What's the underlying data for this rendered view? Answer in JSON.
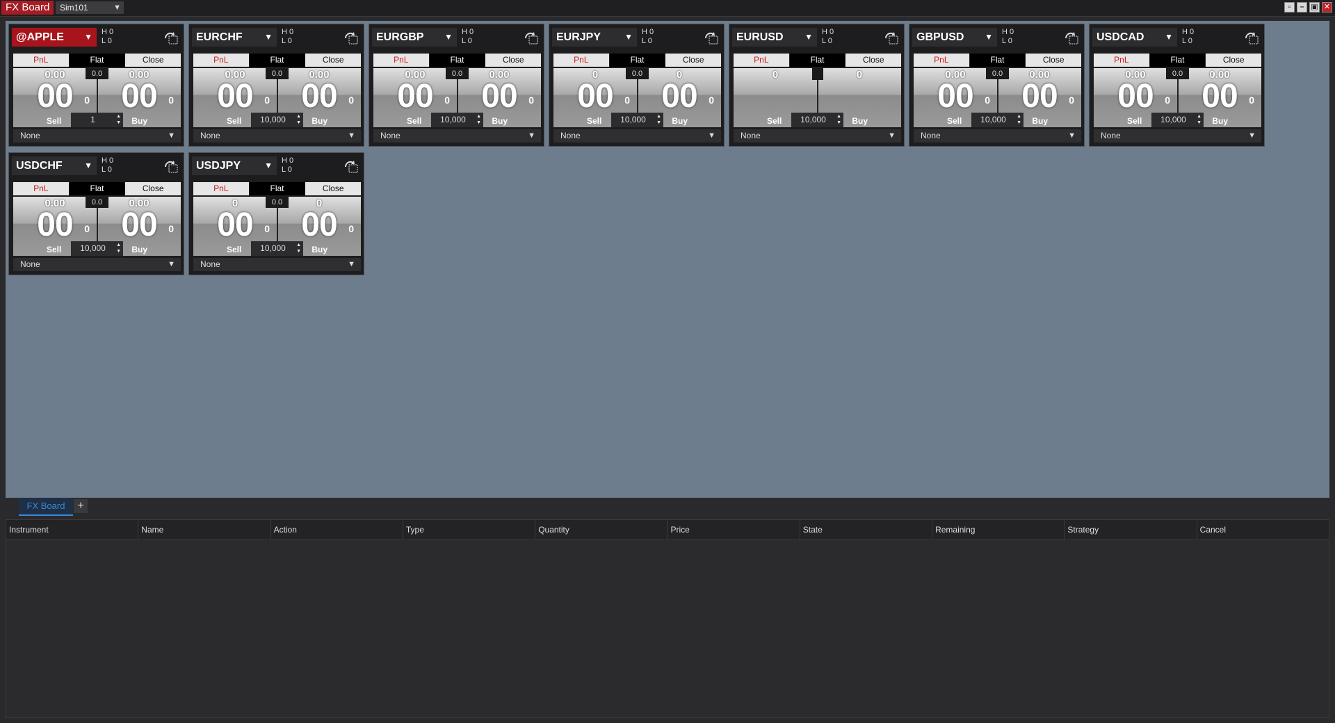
{
  "window": {
    "title": "FX Board",
    "account": "Sim101",
    "controls": [
      "restore-icon",
      "minimize-icon",
      "maximize-icon",
      "close-icon"
    ]
  },
  "tiles": [
    {
      "instrument": "@APPLE",
      "active": true,
      "high": "H 0",
      "low": "L 0",
      "pnl": "PnL",
      "flat": "Flat",
      "close": "Close",
      "sell_small": "0.00",
      "sell_big": "00",
      "sell_pip": "0",
      "spread": "0.0",
      "buy_small": "0.00",
      "buy_big": "00",
      "buy_pip": "0",
      "sell_label": "Sell",
      "buy_label": "Buy",
      "quantity": "1",
      "strategy": "None"
    },
    {
      "instrument": "EURCHF",
      "active": false,
      "high": "H 0",
      "low": "L 0",
      "pnl": "PnL",
      "flat": "Flat",
      "close": "Close",
      "sell_small": "0.00",
      "sell_big": "00",
      "sell_pip": "0",
      "spread": "0.0",
      "buy_small": "0.00",
      "buy_big": "00",
      "buy_pip": "0",
      "sell_label": "Sell",
      "buy_label": "Buy",
      "quantity": "10,000",
      "strategy": "None"
    },
    {
      "instrument": "EURGBP",
      "active": false,
      "high": "H 0",
      "low": "L 0",
      "pnl": "PnL",
      "flat": "Flat",
      "close": "Close",
      "sell_small": "0.00",
      "sell_big": "00",
      "sell_pip": "0",
      "spread": "0.0",
      "buy_small": "0.00",
      "buy_big": "00",
      "buy_pip": "0",
      "sell_label": "Sell",
      "buy_label": "Buy",
      "quantity": "10,000",
      "strategy": "None"
    },
    {
      "instrument": "EURJPY",
      "active": false,
      "high": "H 0",
      "low": "L 0",
      "pnl": "PnL",
      "flat": "Flat",
      "close": "Close",
      "sell_small": "0",
      "sell_big": "00",
      "sell_pip": "0",
      "spread": "0.0",
      "buy_small": "0",
      "buy_big": "00",
      "buy_pip": "0",
      "sell_label": "Sell",
      "buy_label": "Buy",
      "quantity": "10,000",
      "strategy": "None"
    },
    {
      "instrument": "EURUSD",
      "active": false,
      "high": "H 0",
      "low": "L 0",
      "pnl": "PnL",
      "flat": "Flat",
      "close": "Close",
      "sell_small": "0",
      "sell_big": "",
      "sell_pip": "",
      "spread": "",
      "buy_small": "0",
      "buy_big": "",
      "buy_pip": "",
      "sell_label": "Sell",
      "buy_label": "Buy",
      "quantity": "10,000",
      "strategy": "None"
    },
    {
      "instrument": "GBPUSD",
      "active": false,
      "high": "H 0",
      "low": "L 0",
      "pnl": "PnL",
      "flat": "Flat",
      "close": "Close",
      "sell_small": "0.00",
      "sell_big": "00",
      "sell_pip": "0",
      "spread": "0.0",
      "buy_small": "0.00",
      "buy_big": "00",
      "buy_pip": "0",
      "sell_label": "Sell",
      "buy_label": "Buy",
      "quantity": "10,000",
      "strategy": "None"
    },
    {
      "instrument": "USDCAD",
      "active": false,
      "high": "H 0",
      "low": "L 0",
      "pnl": "PnL",
      "flat": "Flat",
      "close": "Close",
      "sell_small": "0.00",
      "sell_big": "00",
      "sell_pip": "0",
      "spread": "0.0",
      "buy_small": "0.00",
      "buy_big": "00",
      "buy_pip": "0",
      "sell_label": "Sell",
      "buy_label": "Buy",
      "quantity": "10,000",
      "strategy": "None"
    },
    {
      "instrument": "USDCHF",
      "active": false,
      "high": "H 0",
      "low": "L 0",
      "pnl": "PnL",
      "flat": "Flat",
      "close": "Close",
      "sell_small": "0.00",
      "sell_big": "00",
      "sell_pip": "0",
      "spread": "0.0",
      "buy_small": "0.00",
      "buy_big": "00",
      "buy_pip": "0",
      "sell_label": "Sell",
      "buy_label": "Buy",
      "quantity": "10,000",
      "strategy": "None"
    },
    {
      "instrument": "USDJPY",
      "active": false,
      "high": "H 0",
      "low": "L 0",
      "pnl": "PnL",
      "flat": "Flat",
      "close": "Close",
      "sell_small": "0",
      "sell_big": "00",
      "sell_pip": "0",
      "spread": "0.0",
      "buy_small": "0",
      "buy_big": "00",
      "buy_pip": "0",
      "sell_label": "Sell",
      "buy_label": "Buy",
      "quantity": "10,000",
      "strategy": "None"
    }
  ],
  "tabs": {
    "items": [
      {
        "label": "FX Board",
        "active": true
      }
    ],
    "add_label": "+"
  },
  "orders": {
    "columns": [
      "Instrument",
      "Name",
      "Action",
      "Type",
      "Quantity",
      "Price",
      "State",
      "Remaining",
      "Strategy",
      "Cancel"
    ],
    "rows": []
  },
  "colors": {
    "accent_red": "#a8141b",
    "board_bg": "#6d7d8d",
    "tab_blue": "#3a88d8",
    "pnl_red": "#d01818"
  }
}
